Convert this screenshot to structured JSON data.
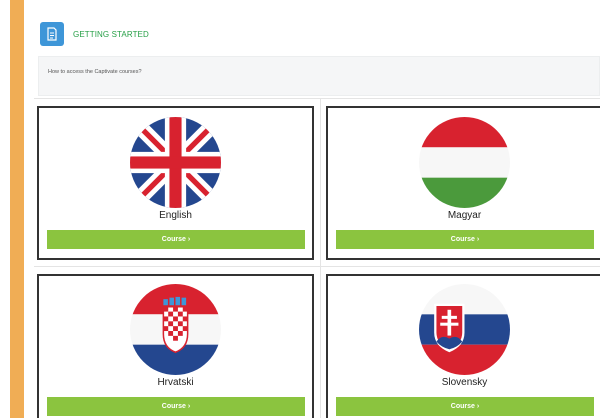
{
  "header": {
    "section_title": "GETTING STARTED",
    "section_icon": "document-icon",
    "question": "How to access the Captivate courses?"
  },
  "colors": {
    "accent_strip": "#f0ad55",
    "badge": "#3e96d8",
    "title_green": "#27a047",
    "button_green": "#8bc43f"
  },
  "courses": [
    {
      "language": "English",
      "button_label": "Course",
      "flag_icon": "uk-flag-icon"
    },
    {
      "language": "Magyar",
      "button_label": "Course",
      "flag_icon": "hungary-flag-icon"
    },
    {
      "language": "Hrvatski",
      "button_label": "Course",
      "flag_icon": "croatia-flag-icon"
    },
    {
      "language": "Slovensky",
      "button_label": "Course",
      "flag_icon": "slovakia-flag-icon"
    }
  ]
}
